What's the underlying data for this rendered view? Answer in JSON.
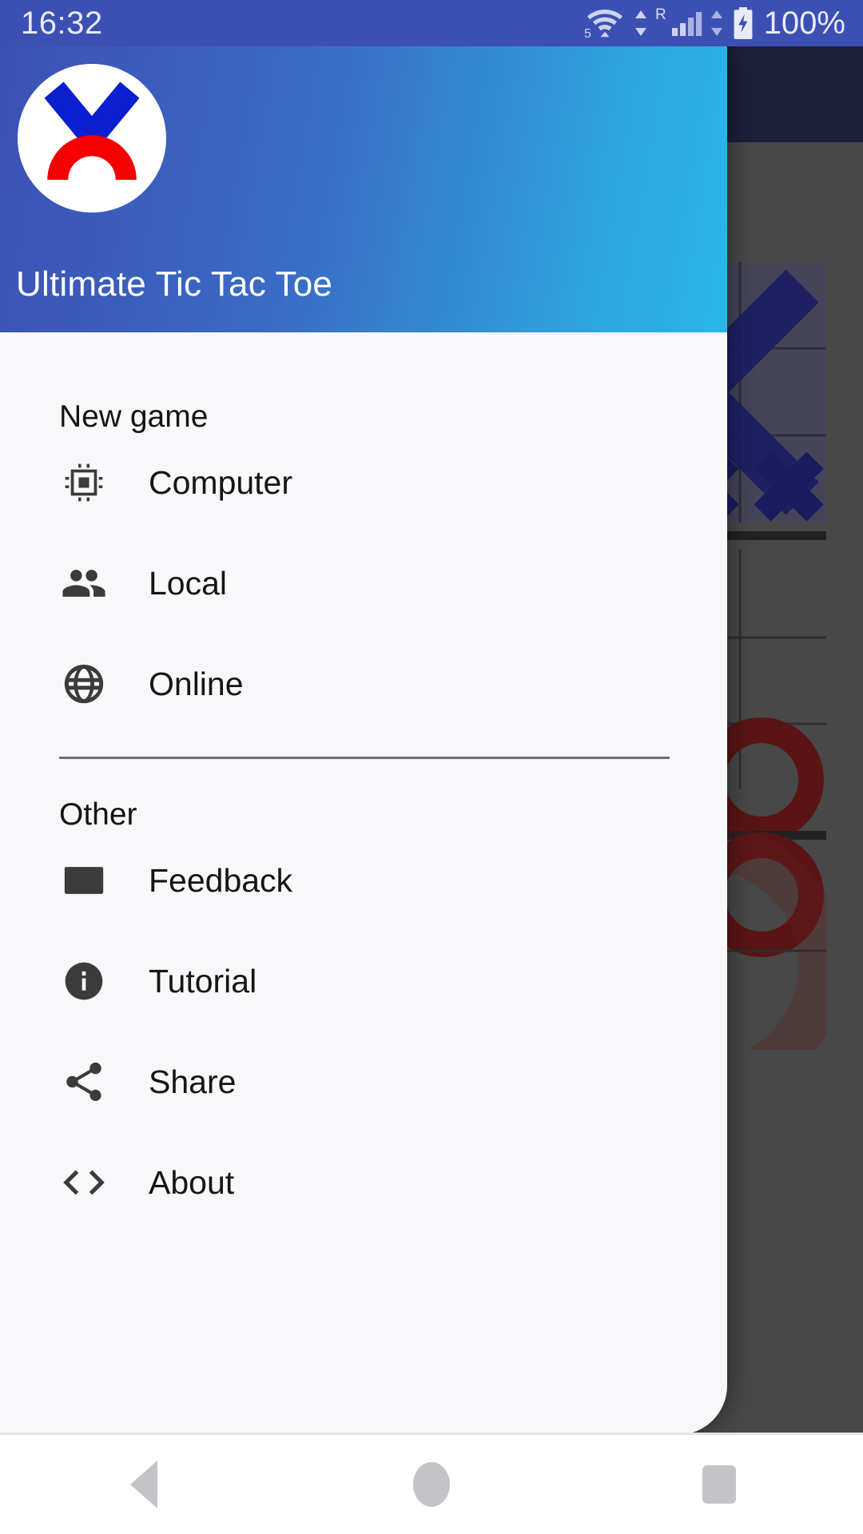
{
  "status_bar": {
    "time": "16:32",
    "battery_text": "100%",
    "roaming_letter": "R",
    "wifi_label": "5",
    "icons": [
      "wifi-icon",
      "data-transfer-icon",
      "roaming-icon",
      "signal-icon",
      "data-transfer-icon-2",
      "battery-charging-icon"
    ],
    "background_color": "#3c50b4",
    "text_color": "#e8eaf6"
  },
  "drawer": {
    "header": {
      "app_title": "Ultimate Tic Tac Toe",
      "logo_name": "ultimate-tic-tac-toe-logo",
      "gradient_start": "#3c50b4",
      "gradient_end": "#28b8ea",
      "logo_x_color": "#0b1fd0",
      "logo_o_color": "#f50000",
      "logo_background": "#ffffff"
    },
    "sections": [
      {
        "title": "New game",
        "items": [
          {
            "label": "Computer",
            "icon": "cpu-chip-icon"
          },
          {
            "label": "Local",
            "icon": "people-group-icon"
          },
          {
            "label": "Online",
            "icon": "globe-icon"
          }
        ]
      },
      {
        "title": "Other",
        "items": [
          {
            "label": "Feedback",
            "icon": "envelope-icon"
          },
          {
            "label": "Tutorial",
            "icon": "info-circle-icon"
          },
          {
            "label": "Share",
            "icon": "share-nodes-icon"
          },
          {
            "label": "About",
            "icon": "code-brackets-icon"
          }
        ]
      }
    ],
    "background_color": "#f8f8fa",
    "text_color": "#151515"
  },
  "game_behind": {
    "toolbar": {
      "background_color": "#1b2250",
      "undo_icon": "undo-arrow-icon"
    },
    "board": {
      "background_color": "#6a6a6a",
      "x_color": "#1a1f9e",
      "o_color": "#9e0e0e",
      "highlight_color": "#585ca0"
    }
  },
  "navigation_bar": {
    "buttons": [
      {
        "label": "Back",
        "icon": "back-triangle-icon"
      },
      {
        "label": "Home",
        "icon": "home-circle-icon"
      },
      {
        "label": "Recents",
        "icon": "recents-square-icon"
      }
    ],
    "background_color": "#ffffff",
    "icon_color": "#c4c4c8"
  }
}
